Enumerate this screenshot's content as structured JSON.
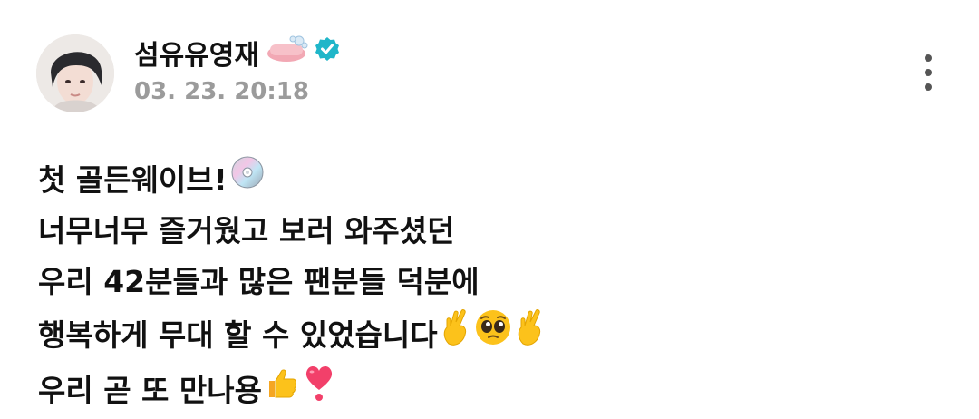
{
  "author": {
    "name": "섬유유영재",
    "name_emoji": "soap-icon",
    "verified": "verified-badge-icon",
    "timestamp": "03. 23. 20:18"
  },
  "menu": {
    "icon": "more-vertical-icon"
  },
  "body": {
    "line1": "첫 골든웨이브! ",
    "line1_emoji": "cd-icon",
    "line2": "너무너무 즐거웠고 보러 와주셨던",
    "line3": "우리 42분들과 많은 팬분들 덕분에",
    "line4": "행복하게 무대 할 수 있었습니다",
    "line4_emojis": [
      "crossed-fingers-icon",
      "pleading-face-icon",
      "crossed-fingers-icon"
    ],
    "line5": "우리 곧 또 만나용",
    "line5_emojis": [
      "thumbs-up-icon",
      "heart-exclamation-icon"
    ]
  },
  "colors": {
    "verified": "#1fb6c9",
    "timestamp": "#9b9b9b",
    "text": "#111111"
  }
}
